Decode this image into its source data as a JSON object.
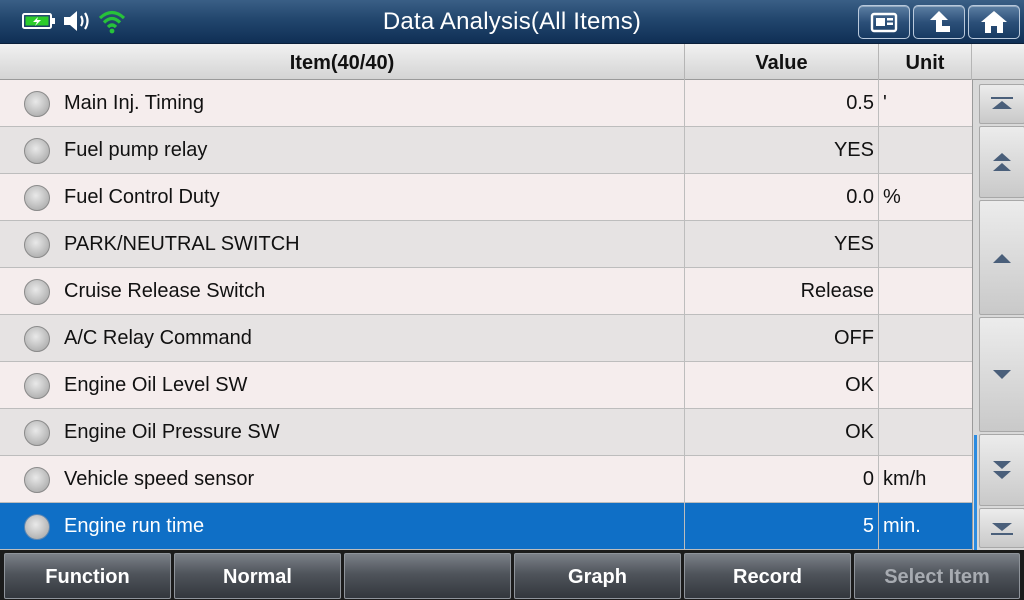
{
  "header": {
    "title": "Data Analysis(All Items)",
    "status_icons": [
      "battery-icon",
      "speaker-icon",
      "wifi-icon"
    ],
    "buttons": [
      "screenshot-icon",
      "back-icon",
      "home-icon"
    ]
  },
  "table": {
    "columns": {
      "item": "Item(40/40)",
      "value": "Value",
      "unit": "Unit"
    },
    "rows": [
      {
        "name": "Main Inj. Timing",
        "value": "0.5",
        "unit": "'"
      },
      {
        "name": "Fuel pump relay",
        "value": "YES",
        "unit": ""
      },
      {
        "name": "Fuel Control Duty",
        "value": "0.0",
        "unit": "%"
      },
      {
        "name": "PARK/NEUTRAL SWITCH",
        "value": "YES",
        "unit": ""
      },
      {
        "name": "Cruise Release Switch",
        "value": "Release",
        "unit": ""
      },
      {
        "name": "A/C Relay Command",
        "value": "OFF",
        "unit": ""
      },
      {
        "name": "Engine Oil Level SW",
        "value": "OK",
        "unit": ""
      },
      {
        "name": "Engine Oil Pressure SW",
        "value": "OK",
        "unit": ""
      },
      {
        "name": "Vehicle speed sensor",
        "value": "0",
        "unit": "km/h"
      },
      {
        "name": "Engine run time",
        "value": "5",
        "unit": "min."
      }
    ],
    "selected_row": 9
  },
  "scrollbar": {
    "buttons": [
      "scroll-top-icon",
      "page-up-icon",
      "line-up-icon",
      "line-down-icon",
      "page-down-icon",
      "scroll-bottom-icon"
    ]
  },
  "footer": {
    "buttons": [
      {
        "label": "Function",
        "enabled": true
      },
      {
        "label": "Normal",
        "enabled": true
      },
      {
        "label": "",
        "enabled": true
      },
      {
        "label": "Graph",
        "enabled": true
      },
      {
        "label": "Record",
        "enabled": true
      },
      {
        "label": "Select Item",
        "enabled": false
      }
    ]
  },
  "colors": {
    "selected_row": "#0f6fc6",
    "title_bar": "#22466d",
    "wifi": "#27c23a",
    "battery": "#2ccc2c"
  }
}
